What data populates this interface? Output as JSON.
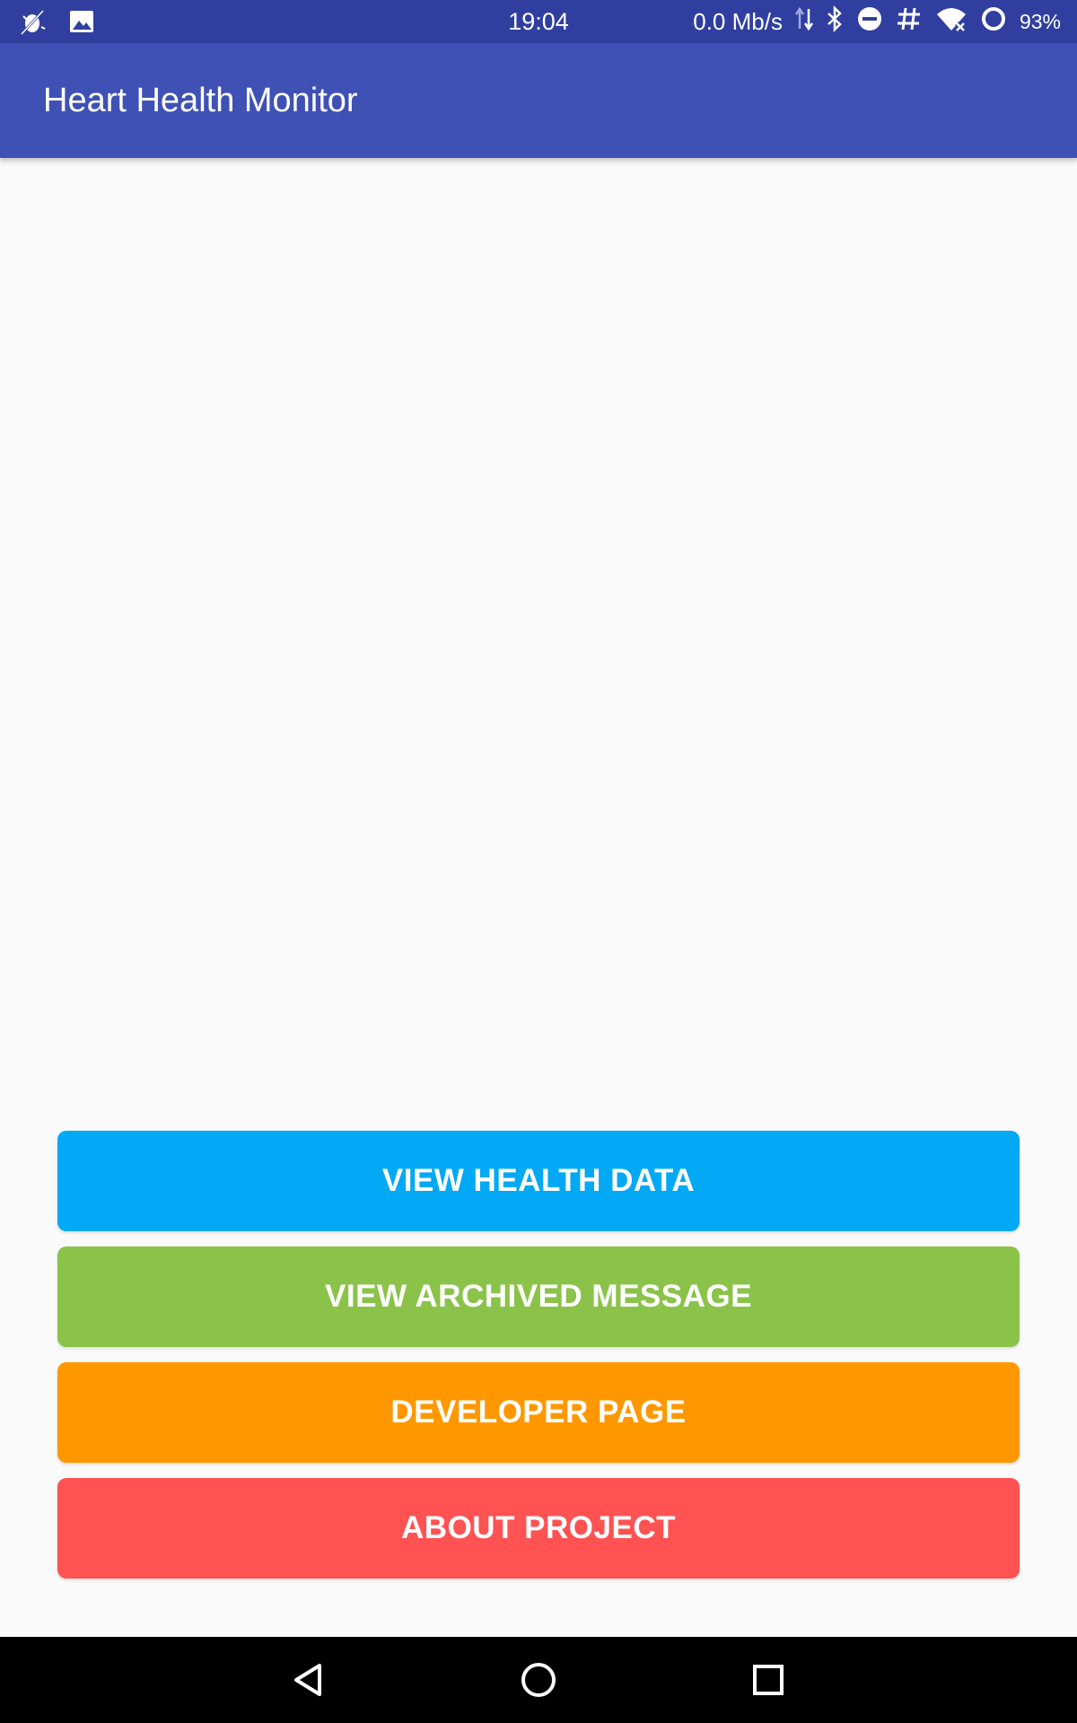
{
  "status_bar": {
    "time": "19:04",
    "network_speed": "0.0 Mb/s",
    "battery": "93%",
    "icons": [
      "debug-icon",
      "image-icon",
      "data-arrows-icon",
      "bluetooth-icon",
      "do-not-disturb-icon",
      "hash-icon",
      "wifi-icon",
      "battery-ring-icon"
    ]
  },
  "app_bar": {
    "title": "Heart Health Monitor"
  },
  "buttons": [
    {
      "label": "VIEW HEALTH DATA",
      "color": "#03a9f4"
    },
    {
      "label": "VIEW ARCHIVED MESSAGE",
      "color": "#8bc34a"
    },
    {
      "label": "DEVELOPER PAGE",
      "color": "#ff9800"
    },
    {
      "label": "ABOUT PROJECT",
      "color": "#ff5252"
    }
  ],
  "nav_bar": {
    "icons": [
      "back-icon",
      "home-icon",
      "recents-icon"
    ]
  },
  "colors": {
    "status_bar": "#303f9f",
    "app_bar": "#3f51b5",
    "background": "#fafafa"
  }
}
